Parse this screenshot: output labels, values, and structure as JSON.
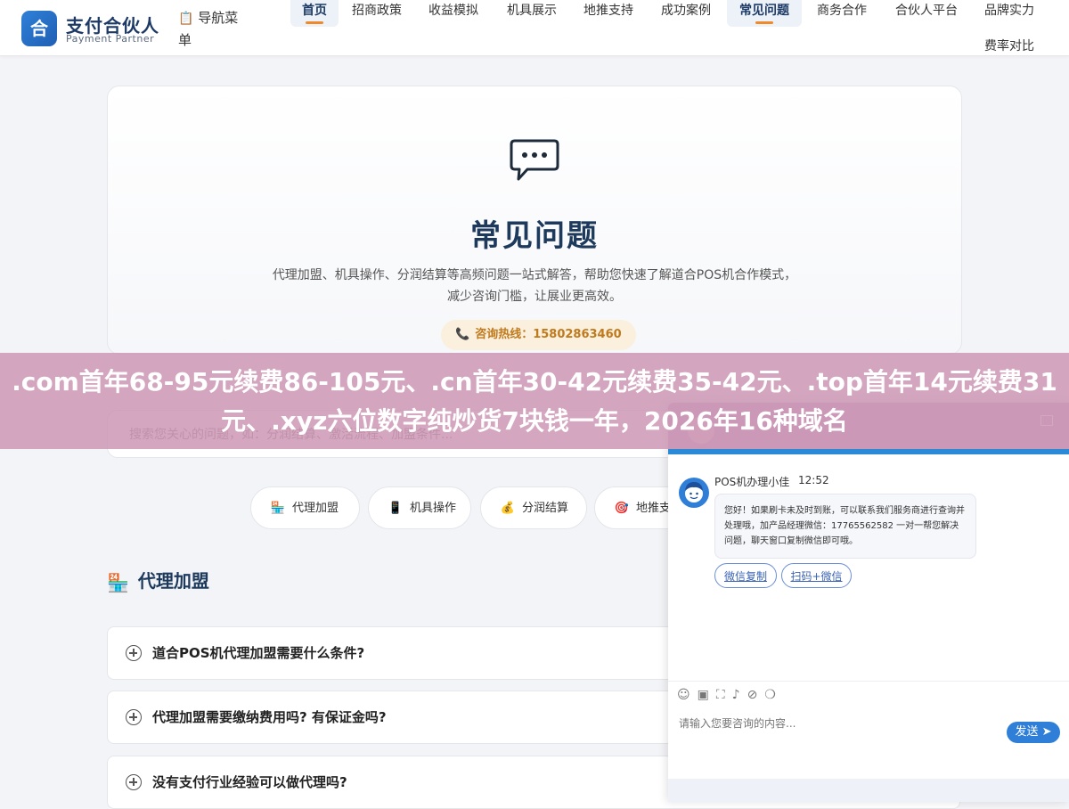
{
  "header": {
    "logo_char": "合",
    "brand_name": "支付合伙人",
    "brand_sub": "Payment Partner",
    "menu_label": "导航菜单",
    "nav": [
      {
        "label": "首页",
        "active": true
      },
      {
        "label": "招商政策",
        "active": false
      },
      {
        "label": "收益模拟",
        "active": false
      },
      {
        "label": "机具展示",
        "active": false
      },
      {
        "label": "地推支持",
        "active": false
      },
      {
        "label": "成功案例",
        "active": false
      },
      {
        "label": "常见问题",
        "active": true
      },
      {
        "label": "商务合作",
        "active": false
      },
      {
        "label": "合伙人平台",
        "active": false
      },
      {
        "label": "品牌实力",
        "active": false
      },
      {
        "label": "费率对比",
        "active": false
      }
    ]
  },
  "hero": {
    "title": "常见问题",
    "desc": "代理加盟、机具操作、分润结算等高频问题一站式解答，帮助您快速了解道合POS机合作模式，减少咨询门槛，让展业更高效。",
    "hotline": "咨询热线：15802863460"
  },
  "search": {
    "placeholder": "搜索您关心的问题，如：分润结算、激活流程、加盟条件..."
  },
  "categories": [
    {
      "label": "代理加盟",
      "icon": "store-icon"
    },
    {
      "label": "机具操作",
      "icon": "phone-icon"
    },
    {
      "label": "分润结算",
      "icon": "money-bag-icon"
    },
    {
      "label": "地推支持",
      "icon": "target-icon"
    }
  ],
  "section": {
    "title": "代理加盟",
    "faqs": [
      "道合POS机代理加盟需要什么条件?",
      "代理加盟需要缴纳费用吗? 有保证金吗?",
      "没有支付行业经验可以做代理吗?"
    ]
  },
  "banner": {
    "text": ".com首年68-95元续费86-105元、.cn首年30-42元续费35-42元、.top首年14元续费31元、.xyz六位数字纯炒货7块钱一年，2026年16种域名"
  },
  "chat": {
    "agent_name": "POS机办理小佳",
    "time": "12:52",
    "message": "您好！如果刷卡未及时到账，可以联系我们服务商进行查询并处理哦，加产品经理微信：17765562582 一对一帮您解决问题，聊天窗口复制微信即可哦。",
    "btn_copy": "微信复制",
    "btn_scan": "扫码+微信",
    "input_placeholder": "请输入您要咨询的内容...",
    "send_label": "发送"
  }
}
